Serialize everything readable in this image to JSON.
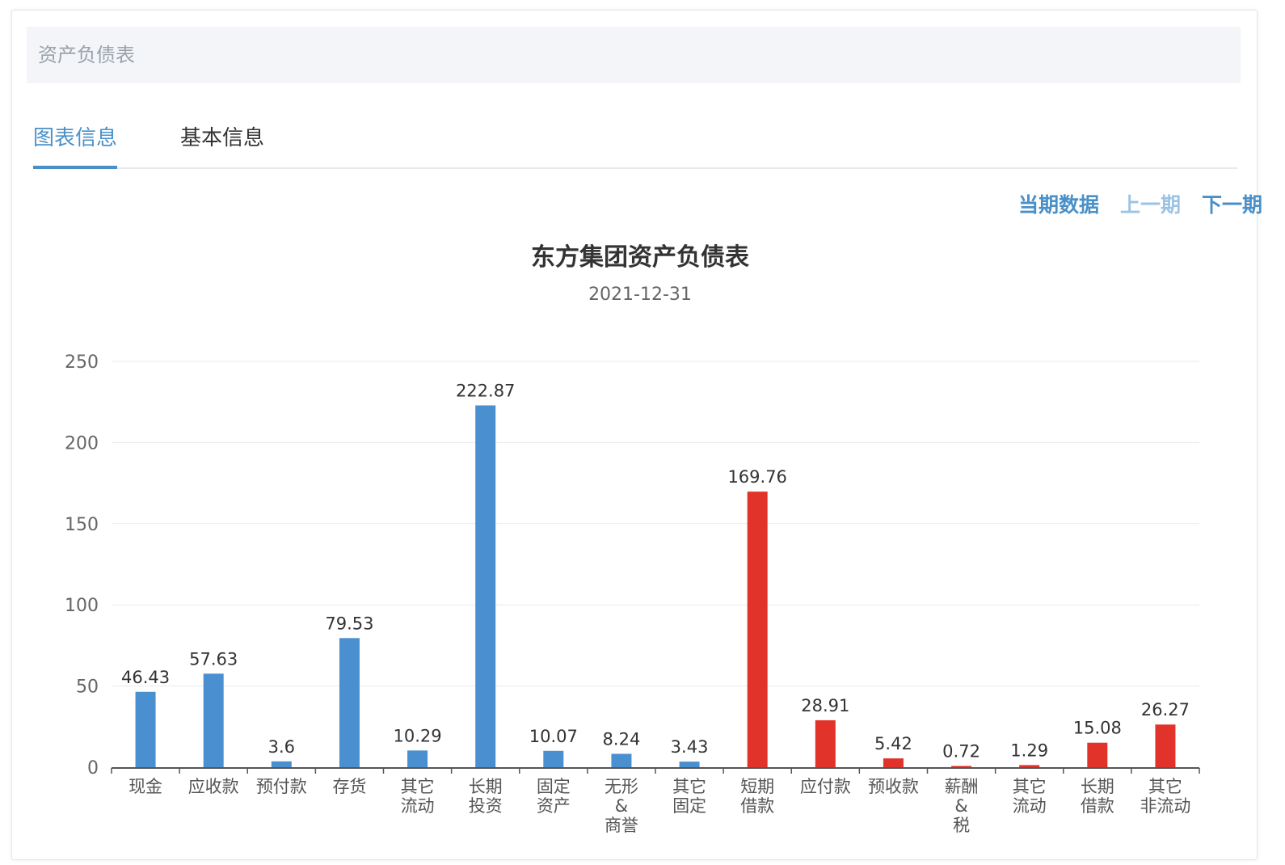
{
  "panel": {
    "title": "资产负债表"
  },
  "tabs": [
    {
      "label": "图表信息",
      "active": true
    },
    {
      "label": "基本信息",
      "active": false
    }
  ],
  "period_nav": {
    "current": "当期数据",
    "prev": "上一期",
    "next": "下一期"
  },
  "colors": {
    "accent": "#4a90c8",
    "assets": "#4a90d0",
    "liabilities": "#e2332a"
  },
  "chart_data": {
    "type": "bar",
    "title": "东方集团资产负债表",
    "subtitle": "2021-12-31",
    "ylim": [
      0,
      250
    ],
    "yticks": [
      0,
      50,
      100,
      150,
      200,
      250
    ],
    "grid": true,
    "categories": [
      [
        "现金"
      ],
      [
        "应收款"
      ],
      [
        "预付款"
      ],
      [
        "存货"
      ],
      [
        "其它",
        "流动"
      ],
      [
        "长期",
        "投资"
      ],
      [
        "固定",
        "资产"
      ],
      [
        "无形",
        "&",
        "商誉"
      ],
      [
        "其它",
        "固定"
      ],
      [
        "短期",
        "借款"
      ],
      [
        "应付款"
      ],
      [
        "预收款"
      ],
      [
        "薪酬",
        "&",
        "税"
      ],
      [
        "其它",
        "流动"
      ],
      [
        "长期",
        "借款"
      ],
      [
        "其它",
        "非流动"
      ]
    ],
    "values": [
      46.43,
      57.63,
      3.6,
      79.53,
      10.29,
      222.87,
      10.07,
      8.24,
      3.43,
      169.76,
      28.91,
      5.42,
      0.72,
      1.29,
      15.08,
      26.27
    ],
    "value_labels": [
      "46.43",
      "57.63",
      "3.6",
      "79.53",
      "10.29",
      "222.87",
      "10.07",
      "8.24",
      "3.43",
      "169.76",
      "28.91",
      "5.42",
      "0.72",
      "1.29",
      "15.08",
      "26.27"
    ],
    "bar_colors": [
      "#4a90d0",
      "#4a90d0",
      "#4a90d0",
      "#4a90d0",
      "#4a90d0",
      "#4a90d0",
      "#4a90d0",
      "#4a90d0",
      "#4a90d0",
      "#e2332a",
      "#e2332a",
      "#e2332a",
      "#e2332a",
      "#e2332a",
      "#e2332a",
      "#e2332a"
    ]
  }
}
